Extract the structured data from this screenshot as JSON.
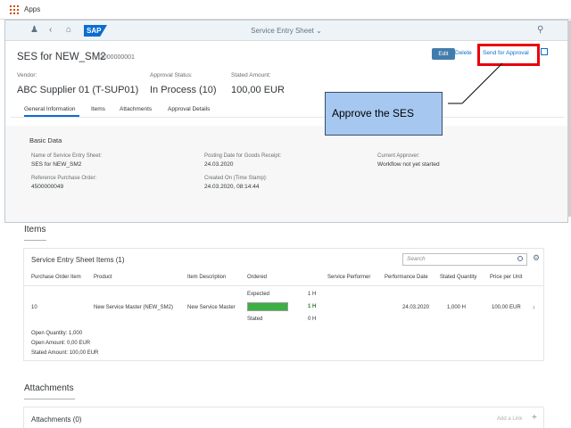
{
  "browser": {
    "apps_label": "Apps"
  },
  "shell": {
    "logo_text": "SAP",
    "title": "Service Entry Sheet"
  },
  "header": {
    "title": "SES for NEW_SM2",
    "id": "2000000001",
    "actions": {
      "edit": "Edit",
      "delete": "Delete",
      "send_for_approval": "Send for Approval"
    },
    "fields": [
      {
        "label": "Vendor:",
        "value": "ABC Supplier 01 (T-SUP01)"
      },
      {
        "label": "Approval Status:",
        "value": "In Process (10)"
      },
      {
        "label": "Stated Amount:",
        "value": "100,00  EUR"
      }
    ]
  },
  "tabs": [
    "General Information",
    "Items",
    "Attachments",
    "Approval Details"
  ],
  "basic_data": {
    "title": "Basic Data",
    "fields": [
      {
        "label": "Name of Service Entry Sheet:",
        "value": "SES for NEW_SM2"
      },
      {
        "label": "Posting Date for Goods Receipt:",
        "value": "24.03.2020"
      },
      {
        "label": "Current Approver:",
        "value": "Workflow not yet started"
      },
      {
        "label": "Reference Purchase Order:",
        "value": "4500000049"
      },
      {
        "label": "Created On (Time Stamp):",
        "value": "24.03.2020, 08:14:44"
      }
    ]
  },
  "callout": {
    "text": "Approve the SES"
  },
  "items_section": {
    "heading": "Items",
    "table_title": "Service Entry Sheet Items (1)",
    "search_placeholder": "Search",
    "columns": [
      "Purchase Order Item",
      "Product",
      "Item Description",
      "Ordered",
      "Service Performer",
      "Performance Date",
      "Stated Quantity",
      "Price per Unit"
    ],
    "row": {
      "po_item": "10",
      "product": "New Service Master (NEW_SM2)",
      "description": "New Service Master",
      "expected_label": "Expected",
      "expected_value": "1 H",
      "progress_value": "1 H",
      "progress_fraction": 1.0,
      "stated_label": "Stated",
      "stated_value": "0 H",
      "performance_date": "24.03.2020",
      "stated_quantity": "1,000  H",
      "price_per_unit": "100,00  EUR"
    },
    "summary": [
      "Open Quantity:  1,000",
      "Open Amount:  0,00  EUR",
      "Stated Amount:  100,00  EUR"
    ]
  },
  "attachments_section": {
    "heading": "Attachments",
    "title": "Attachments (0)",
    "add_link": "Add a Link"
  },
  "colors": {
    "accent": "#0a6ed1",
    "highlight": "#e8000b",
    "progress": "#3cb043",
    "callout": "#a6c8f0"
  }
}
